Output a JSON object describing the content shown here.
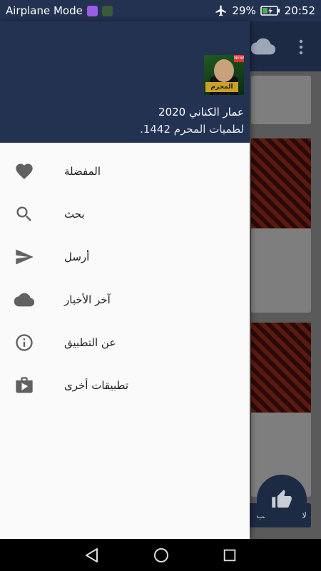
{
  "status_bar": {
    "left_text": "Airplane Mode",
    "battery_percent": "29%",
    "time": "20:52"
  },
  "drawer": {
    "header": {
      "title": "عمار الكناني 2020",
      "subtitle": "لطميات المحرم 1442.",
      "thumb_text": "المحرم 1442",
      "thumb_badge": "NEW"
    },
    "items": [
      {
        "label": "المفضلة",
        "icon": "heart-icon"
      },
      {
        "label": "بحث",
        "icon": "search-icon"
      },
      {
        "label": "أرسل",
        "icon": "send-icon"
      },
      {
        "label": "آخر الأخبار",
        "icon": "cloud-icon"
      },
      {
        "label": "عن التطبيق",
        "icon": "info-icon"
      },
      {
        "label": "تطبيقات أخرى",
        "icon": "shop-icon"
      }
    ]
  },
  "background": {
    "cta_text": "لا تنسى تعجب"
  },
  "colors": {
    "header": "#233250",
    "drawer_bg": "#fafafa",
    "icon": "#616161"
  }
}
